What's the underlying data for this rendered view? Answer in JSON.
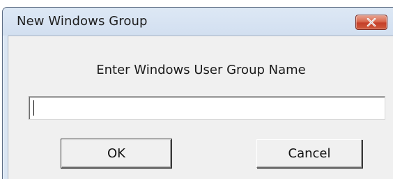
{
  "window": {
    "title": "New Windows Group"
  },
  "dialog": {
    "prompt": "Enter Windows User Group Name",
    "group_name": {
      "value": "",
      "placeholder": ""
    },
    "ok_label": "OK",
    "cancel_label": "Cancel"
  },
  "icons": {
    "close": "close-icon"
  },
  "colors": {
    "title_bar": "#d2dff0",
    "close_button": "#c4402a",
    "client_area": "#f0f0f0"
  }
}
